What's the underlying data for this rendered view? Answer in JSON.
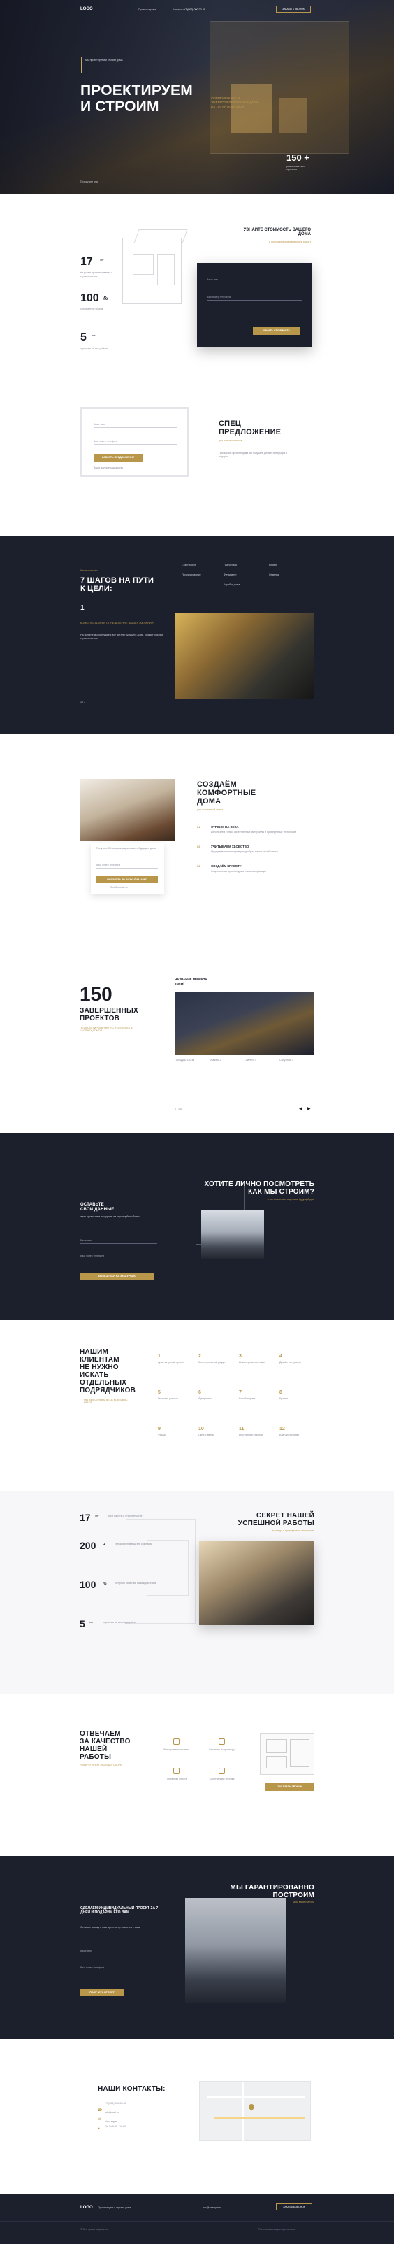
{
  "header": {
    "logo": "LOGO",
    "nav_links": [
      "Проекты домов",
      "Контакты"
    ],
    "phone": "+7 (000) 000-00-00",
    "callback": "Заказать звонок"
  },
  "hero": {
    "tag": "Мы проектируем и строим дома",
    "title_line1": "ПРОЕКТИРУЕМ",
    "title_line2": "И СТРОИМ",
    "subtitle": "современные и энергоэффективные дома из 100 м² под ключ",
    "count": "150 +",
    "count_caption": "реализованных проектов",
    "scroll": "Прокрутите вниз"
  },
  "calc": {
    "stat1_value": "17",
    "stat1_unit": "лет",
    "stat1_text": "на рынке проектирования и строительства",
    "stat2_value": "100",
    "stat2_unit": "%",
    "stat2_text": "соблюдение сроков",
    "stat3_value": "5",
    "stat3_unit": "лет",
    "stat3_text": "гарантия на все работы",
    "form_title": "УЗНАЙТЕ СТОИМОСТЬ ВАШЕГО ДОМА",
    "form_sub": "и получите индивидуальный расчёт",
    "name_ph": "Ваше имя",
    "phone_ph": "Ваш номер телефона",
    "button": "Узнать стоимость"
  },
  "offer": {
    "name_ph": "Ваше имя",
    "phone_ph": "Ваш номер телефона",
    "button": "Забрать предложение",
    "note": "Ваши данные защищены",
    "title_line1": "СПЕЦ",
    "title_line2": "ПРЕДЛОЖЕНИЕ",
    "sub": "для новых клиентов",
    "text": "При заказе проекта дома вы получите дизайн интерьера в подарок"
  },
  "steps": {
    "tag": "Как мы строим",
    "title_line1": "7 ШАГОВ НА ПУТИ",
    "title_line2": "К ЦЕЛИ:",
    "number": "1",
    "step_title": "Консультация и определение ваших желаний",
    "step_text": "На встрече мы обсуждаем все детали будущего дома, бюджет и сроки строительства.",
    "list": [
      "Старт работ",
      "Проектирование",
      "Подготовка",
      "Фундамент",
      "Коробка дома",
      "Кровля",
      "Отделка"
    ],
    "pager": "1 / 7"
  },
  "comfort": {
    "title_line1": "СОЗДАЁМ",
    "title_line2": "КОМФОРТНЫЕ",
    "title_line3": "ДОМА",
    "sub": "для счастливой жизни",
    "items": [
      {
        "num": "01",
        "title": "СТРОИМ НА ВЕКА",
        "text": "Используем только качественные материалы и проверенные технологии"
      },
      {
        "num": "02",
        "title": "УЧИТЫВАЕМ УДОБСТВО",
        "text": "Продумываем планировку под образ жизни вашей семьи"
      },
      {
        "num": "03",
        "title": "СОЗДАЁМ КРАСОТУ",
        "text": "Современная архитектура и стильные фасады"
      }
    ],
    "form_text": "Получите 3D-визуализацию вашего будущего дома",
    "phone_ph": "Ваш номер телефона",
    "button": "Получить 3D-визуализацию",
    "note": "Это бесплатно"
  },
  "projects": {
    "count": "150",
    "title_line1": "ЗАВЕРШЕННЫХ",
    "title_line2": "ПРОЕКТОВ",
    "sub": "по проектированию и строительству частных домов",
    "project_label": "НАЗВАНИЕ ПРОЕКТА",
    "project_area": "150 М²",
    "specs": [
      "Площадь: 150 м²",
      "Этажей: 2",
      "Спален: 3",
      "Санузлов: 2"
    ],
    "pager": "1 / 150"
  },
  "visit": {
    "title_line1": "ХОТИТЕ ЛИЧНО ПОСМОТРЕТЬ",
    "title_line2": "КАК МЫ СТРОИМ?",
    "sub": "и как можно выглядит ваш будущий дом",
    "left_title_line1": "ОСТАВЬТЕ",
    "left_title_line2": "СВОИ ДАННЫЕ",
    "left_text": "и мы организуем экскурсию на строящийся объект",
    "name_ph": "Ваше имя",
    "phone_ph": "Ваш номер телефона",
    "button": "Записаться на экскурсию"
  },
  "clients": {
    "title_line1": "НАШИМ",
    "title_line2": "КЛИЕНТАМ",
    "title_line3": "НЕ НУЖНО",
    "title_line4": "ИСКАТЬ",
    "title_line5": "ОТДЕЛЬНЫХ",
    "title_line6": "ПОДРЯДЧИКОВ",
    "sub": "мы выполняем весь комплекс работ",
    "services": [
      {
        "num": "1",
        "label": "Архитектурный проект"
      },
      {
        "num": "2",
        "label": "Конструктивный раздел"
      },
      {
        "num": "3",
        "label": "Инженерные системы"
      },
      {
        "num": "4",
        "label": "Дизайн интерьера"
      },
      {
        "num": "5",
        "label": "Геология участка"
      },
      {
        "num": "6",
        "label": "Фундамент"
      },
      {
        "num": "7",
        "label": "Коробка дома"
      },
      {
        "num": "8",
        "label": "Кровля"
      },
      {
        "num": "9",
        "label": "Фасад"
      },
      {
        "num": "10",
        "label": "Окна и двери"
      },
      {
        "num": "11",
        "label": "Внутренняя отделка"
      },
      {
        "num": "12",
        "label": "Благоустройство"
      }
    ]
  },
  "secret": {
    "title_line1": "СЕКРЕТ НАШЕЙ",
    "title_line2": "УСПЕШНОЙ РАБОТЫ",
    "sub": "команда и проверенные технологии",
    "stats": [
      {
        "value": "17",
        "unit": "лет",
        "text": "опыт работы в строительстве"
      },
      {
        "value": "200",
        "unit": "+",
        "text": "специалистов в штате компании"
      },
      {
        "value": "100",
        "unit": "%",
        "text": "контроль качества на каждом этапе"
      },
      {
        "value": "5",
        "unit": "лет",
        "text": "гарантия на все виды работ"
      }
    ]
  },
  "quality": {
    "title_line1": "ОТВЕЧАЕМ",
    "title_line2": "ЗА КАЧЕСТВО",
    "title_line3": "НАШЕЙ",
    "title_line4": "РАБОТЫ",
    "sub": "и закрепляем это в договоре",
    "items": [
      "Фиксированная смета",
      "Гарантия по договору",
      "Поэтапная оплата",
      "Собственная техника"
    ],
    "button": "Заказать звонок"
  },
  "guarantee": {
    "title_line1": "МЫ ГАРАНТИРОВАННО",
    "title_line2": "ПОСТРОИМ",
    "sub": "дом вашей мечты",
    "left_title": "СДЕЛАЕМ ИНДИВИДУАЛЬНЫЙ ПРОЕКТ ЗА 7 ДНЕЙ И ПОДАРИМ ЕГО ВАМ",
    "left_text": "Оставьте заявку и наш архитектор свяжется с вами",
    "name_ph": "Ваше имя",
    "phone_ph": "Ваш номер телефона",
    "button": "Получить проект"
  },
  "contacts": {
    "title": "НАШИ КОНТАКТЫ:",
    "phone": "+7 (000) 000-00-00",
    "email": "info@mail.ru",
    "address": "Наш адрес",
    "hours": "Пн-Пт 9:00 - 18:00"
  },
  "footer": {
    "logo": "LOGO",
    "tagline": "Проектируем и строим дома",
    "email": "info@example.ru",
    "callback": "Заказать звонок",
    "copyright": "© Все права защищены",
    "policy": "Политика конфиденциальности"
  },
  "colors": {
    "gold": "#b9974a",
    "dark": "#1c1f2c"
  }
}
